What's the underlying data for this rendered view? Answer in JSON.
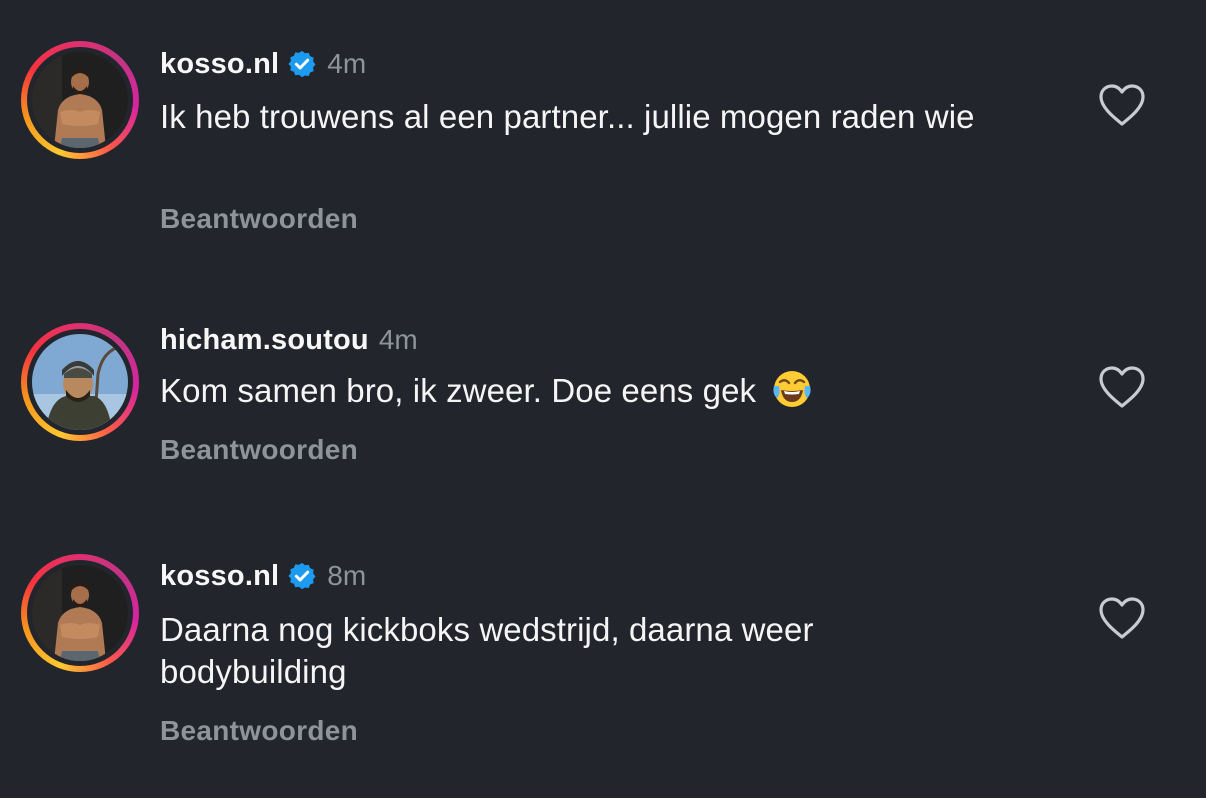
{
  "comments": [
    {
      "username": "kosso.nl",
      "verified": true,
      "time": "4m",
      "text": "Ik heb trouwens al een partner... jullie mogen raden wie",
      "reply_label": "Beantwoorden",
      "avatar": "shirtless-bodybuilder"
    },
    {
      "username": "hicham.soutou",
      "verified": false,
      "time": "4m",
      "text": "Kom samen bro, ik zweer. Doe eens gek",
      "emoji": "face-with-tears-of-joy",
      "reply_label": "Beantwoorden",
      "avatar": "man-with-beanie"
    },
    {
      "username": "kosso.nl",
      "verified": true,
      "time": "8m",
      "text": "Daarna nog kickboks wedstrijd, daarna weer bodybuilding",
      "reply_label": "Beantwoorden",
      "avatar": "shirtless-bodybuilder"
    }
  ],
  "colors": {
    "background": "#22252c",
    "text": "#f5f5f5",
    "muted": "#8e939c",
    "verified_badge": "#1d9bf0"
  },
  "icons": {
    "like": "heart-outline-icon",
    "verified": "verified-badge-icon"
  }
}
